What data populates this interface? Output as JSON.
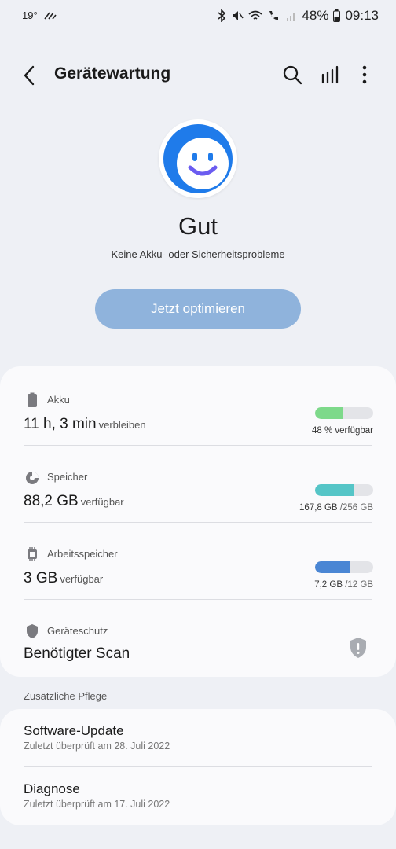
{
  "status_bar": {
    "temperature": "19°",
    "battery": "48%",
    "time": "09:13"
  },
  "app_bar": {
    "title": "Gerätewartung"
  },
  "hero": {
    "status": "Gut",
    "subtitle": "Keine Akku- oder Sicherheitsprobleme",
    "button_label": "Jetzt optimieren",
    "accent_color": "#1f7bea",
    "smile_color": "#6b5cf0"
  },
  "items": [
    {
      "label": "Akku",
      "value": "11 h, 3 min",
      "unit": "verbleiben",
      "right": "48 % verfügbar",
      "right_muted": "",
      "fill_fraction": 0.48,
      "color": "#7dd98a",
      "icon": "battery-icon"
    },
    {
      "label": "Speicher",
      "value": "88,2 GB",
      "unit": "verfügbar",
      "right": "167,8 GB",
      "right_muted": " /256 GB",
      "fill_fraction": 0.66,
      "color": "#55c5c7",
      "icon": "storage-pie-icon"
    },
    {
      "label": "Arbeitsspeicher",
      "value": "3 GB",
      "unit": "verfügbar",
      "right": "7,2 GB",
      "right_muted": " /12 GB",
      "fill_fraction": 0.6,
      "color": "#4a86d4",
      "icon": "memory-chip-icon"
    },
    {
      "label": "Geräteschutz",
      "value": "Benötigter Scan",
      "icon": "shield-icon"
    }
  ],
  "extra": {
    "section_label": "Zusätzliche Pflege",
    "items": [
      {
        "title": "Software-Update",
        "subtitle": "Zuletzt überprüft am 28. Juli 2022"
      },
      {
        "title": "Diagnose",
        "subtitle": "Zuletzt überprüft am 17. Juli 2022"
      }
    ]
  }
}
